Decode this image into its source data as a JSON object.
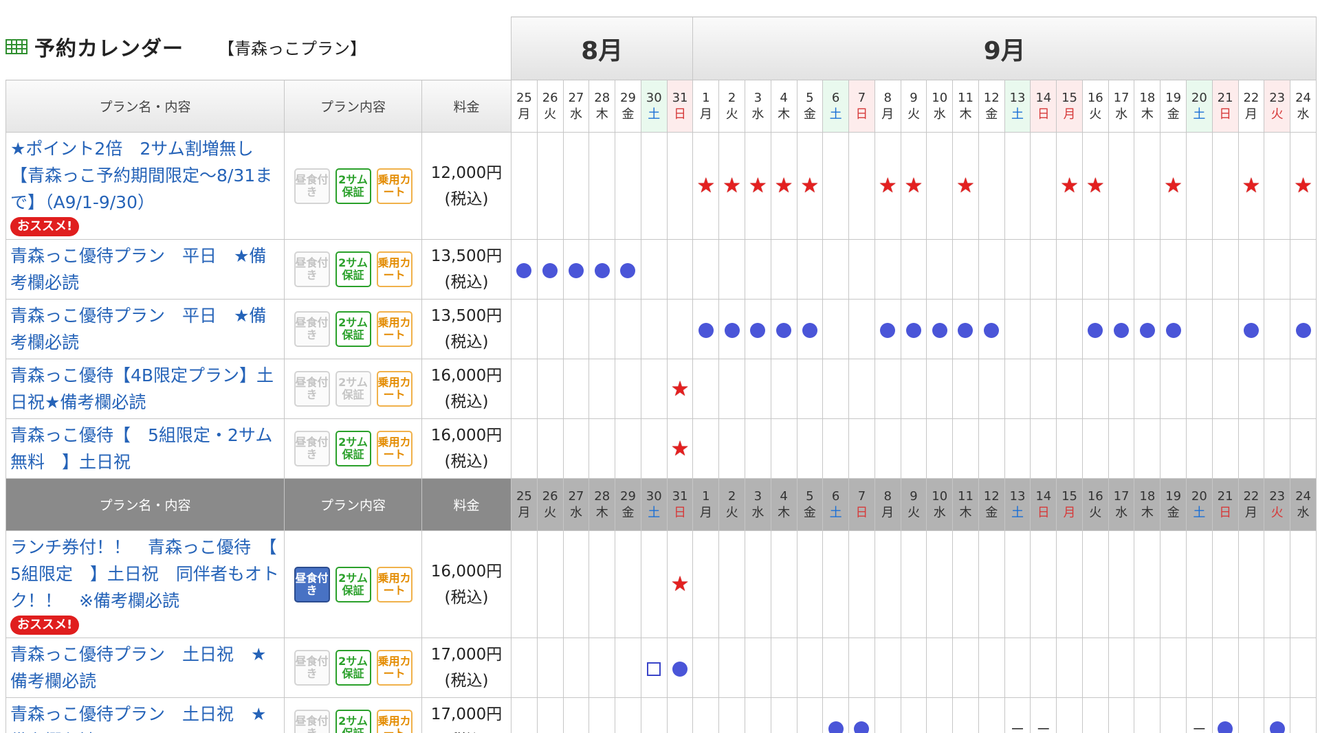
{
  "header": {
    "title": "予約カレンダー",
    "plan_label": "【青森っこプラン】"
  },
  "months": [
    {
      "label": "8月",
      "span": 7
    },
    {
      "label": "9月",
      "span": 24
    }
  ],
  "columns": {
    "plan": "プラン名・内容",
    "content": "プラン内容",
    "price": "料金"
  },
  "days": [
    {
      "d": "25",
      "w": "月",
      "t": ""
    },
    {
      "d": "26",
      "w": "火",
      "t": ""
    },
    {
      "d": "27",
      "w": "水",
      "t": ""
    },
    {
      "d": "28",
      "w": "木",
      "t": ""
    },
    {
      "d": "29",
      "w": "金",
      "t": ""
    },
    {
      "d": "30",
      "w": "土",
      "t": "sat"
    },
    {
      "d": "31",
      "w": "日",
      "t": "sun"
    },
    {
      "d": "1",
      "w": "月",
      "t": ""
    },
    {
      "d": "2",
      "w": "火",
      "t": ""
    },
    {
      "d": "3",
      "w": "水",
      "t": ""
    },
    {
      "d": "4",
      "w": "木",
      "t": ""
    },
    {
      "d": "5",
      "w": "金",
      "t": ""
    },
    {
      "d": "6",
      "w": "土",
      "t": "sat"
    },
    {
      "d": "7",
      "w": "日",
      "t": "sun"
    },
    {
      "d": "8",
      "w": "月",
      "t": ""
    },
    {
      "d": "9",
      "w": "火",
      "t": ""
    },
    {
      "d": "10",
      "w": "水",
      "t": ""
    },
    {
      "d": "11",
      "w": "木",
      "t": ""
    },
    {
      "d": "12",
      "w": "金",
      "t": ""
    },
    {
      "d": "13",
      "w": "土",
      "t": "sat"
    },
    {
      "d": "14",
      "w": "日",
      "t": "sun"
    },
    {
      "d": "15",
      "w": "月",
      "t": "sun"
    },
    {
      "d": "16",
      "w": "火",
      "t": ""
    },
    {
      "d": "17",
      "w": "水",
      "t": ""
    },
    {
      "d": "18",
      "w": "木",
      "t": ""
    },
    {
      "d": "19",
      "w": "金",
      "t": ""
    },
    {
      "d": "20",
      "w": "土",
      "t": "sat"
    },
    {
      "d": "21",
      "w": "日",
      "t": "sun"
    },
    {
      "d": "22",
      "w": "月",
      "t": ""
    },
    {
      "d": "23",
      "w": "火",
      "t": "sun"
    },
    {
      "d": "24",
      "w": "水",
      "t": ""
    }
  ],
  "icon_labels": {
    "lunch": "昼食付き",
    "two": "2サム保証",
    "cart": "乗用カート"
  },
  "groups": [
    {
      "header_dark": false,
      "plans": [
        {
          "name": "★ポイント2倍　2サム割増無し【青森っこ予約期間限定～8/31まで】（A9/1-9/30）",
          "badge": "おススメ!",
          "icons": {
            "lunch": false,
            "two": true,
            "cart": true
          },
          "price": "12,000円",
          "tax": "(税込)",
          "marks": {
            "7": "star",
            "8": "star",
            "9": "star",
            "10": "star",
            "11": "star",
            "14": "star",
            "15": "star",
            "17": "star",
            "21": "star",
            "22": "star",
            "25": "star",
            "28": "star",
            "30": "star"
          }
        },
        {
          "name": "青森っこ優待プラン　平日　★備考欄必読",
          "badge": "",
          "icons": {
            "lunch": false,
            "two": true,
            "cart": true
          },
          "price": "13,500円",
          "tax": "(税込)",
          "marks": {
            "0": "circle",
            "1": "circle",
            "2": "circle",
            "3": "circle",
            "4": "circle"
          }
        },
        {
          "name": "青森っこ優待プラン　平日　★備考欄必読",
          "badge": "",
          "icons": {
            "lunch": false,
            "two": true,
            "cart": true
          },
          "price": "13,500円",
          "tax": "(税込)",
          "marks": {
            "7": "circle",
            "8": "circle",
            "9": "circle",
            "10": "circle",
            "11": "circle",
            "14": "circle",
            "15": "circle",
            "16": "circle",
            "17": "circle",
            "18": "circle",
            "22": "circle",
            "23": "circle",
            "24": "circle",
            "25": "circle",
            "28": "circle",
            "30": "circle"
          }
        },
        {
          "name": "青森っこ優待【4B限定プラン】土日祝★備考欄必読",
          "badge": "",
          "icons": {
            "lunch": false,
            "two": false,
            "cart": true
          },
          "price": "16,000円",
          "tax": "(税込)",
          "marks": {
            "6": "star"
          }
        },
        {
          "name": "青森っこ優待【　5組限定・2サム無料　】土日祝",
          "badge": "",
          "icons": {
            "lunch": false,
            "two": true,
            "cart": true
          },
          "price": "16,000円",
          "tax": "(税込)",
          "marks": {
            "6": "star"
          }
        }
      ]
    },
    {
      "header_dark": true,
      "plans": [
        {
          "name": "ランチ券付！！　青森っこ優待　【　5組限定　】土日祝　同伴者もオトク！！　※備考欄必読",
          "badge": "おススメ!",
          "icons": {
            "lunch": true,
            "two": true,
            "cart": true
          },
          "price": "16,000円",
          "tax": "(税込)",
          "marks": {
            "6": "star"
          }
        },
        {
          "name": "青森っこ優待プラン　土日祝　★備考欄必読",
          "badge": "",
          "icons": {
            "lunch": false,
            "two": true,
            "cart": true
          },
          "price": "17,000円",
          "tax": "(税込)",
          "marks": {
            "5": "square",
            "6": "circle"
          }
        },
        {
          "name": "青森っこ優待プラン　土日祝　★備考欄必読",
          "badge": "",
          "icons": {
            "lunch": false,
            "two": true,
            "cart": true
          },
          "price": "17,000円",
          "tax": "(税込)",
          "marks": {
            "12": "circle",
            "13": "circle",
            "19": "dash",
            "20": "dash",
            "26": "dash",
            "27": "circle",
            "29": "circle"
          }
        }
      ]
    }
  ],
  "colors": {
    "link": "#2563b8",
    "star": "#e32020",
    "circle": "#4a55d8",
    "sat_bg": "#e9f9ee",
    "sun_bg": "#fdecec",
    "badge": "#e01e1e"
  }
}
